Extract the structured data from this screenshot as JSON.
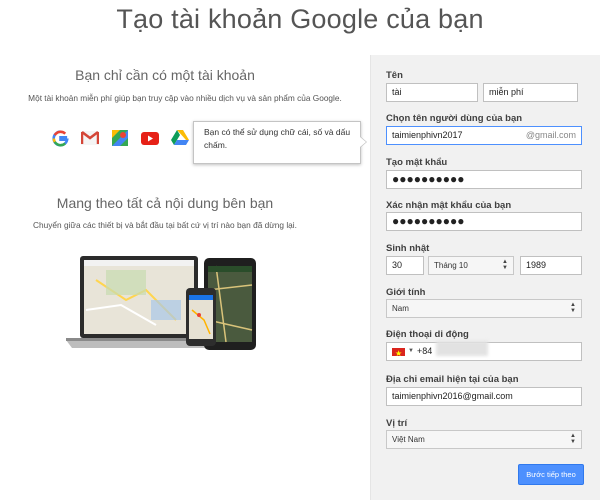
{
  "title": "Tạo tài khoản Google của bạn",
  "left": {
    "heading1": "Bạn chỉ cần có một tài khoản",
    "text1": "Một tài khoản miễn phí giúp bạn truy cập vào nhiều dịch vụ và sản phẩm của Google.",
    "heading2": "Mang theo tất cả nội dung bên bạn",
    "text2": "Chuyển giữa các thiết bị và bắt đầu tại bất cứ vị trí nào bạn đã dừng lại.",
    "icons": [
      "google-icon",
      "gmail-icon",
      "maps-icon",
      "youtube-icon",
      "drive-icon"
    ],
    "tooltip": "Bạn có thể sử dụng chữ cái, số và dấu chấm."
  },
  "form": {
    "name_label": "Tên",
    "first_name": "tài",
    "last_name": "miễn phí",
    "username_label": "Chọn tên người dùng của bạn",
    "username": "taimienphivn2017",
    "username_suffix": "@gmail.com",
    "password_label": "Tạo mật khẩu",
    "password": "●●●●●●●●●●",
    "confirm_label": "Xác nhận mật khẩu của bạn",
    "confirm": "●●●●●●●●●●",
    "birthday_label": "Sinh nhật",
    "day": "30",
    "month": "Tháng 10",
    "year": "1989",
    "gender_label": "Giới tính",
    "gender": "Nam",
    "phone_label": "Điện thoại di động",
    "phone_prefix": "+84",
    "email_label": "Địa chỉ email hiện tại của bạn",
    "email": "taimienphivn2016@gmail.com",
    "location_label": "Vị trí",
    "location": "Việt Nam",
    "next_button": "Bước tiếp theo"
  },
  "colors": {
    "accent": "#4d90fe",
    "panel": "#f1f1f1",
    "focus_border": "#4d90fe"
  }
}
